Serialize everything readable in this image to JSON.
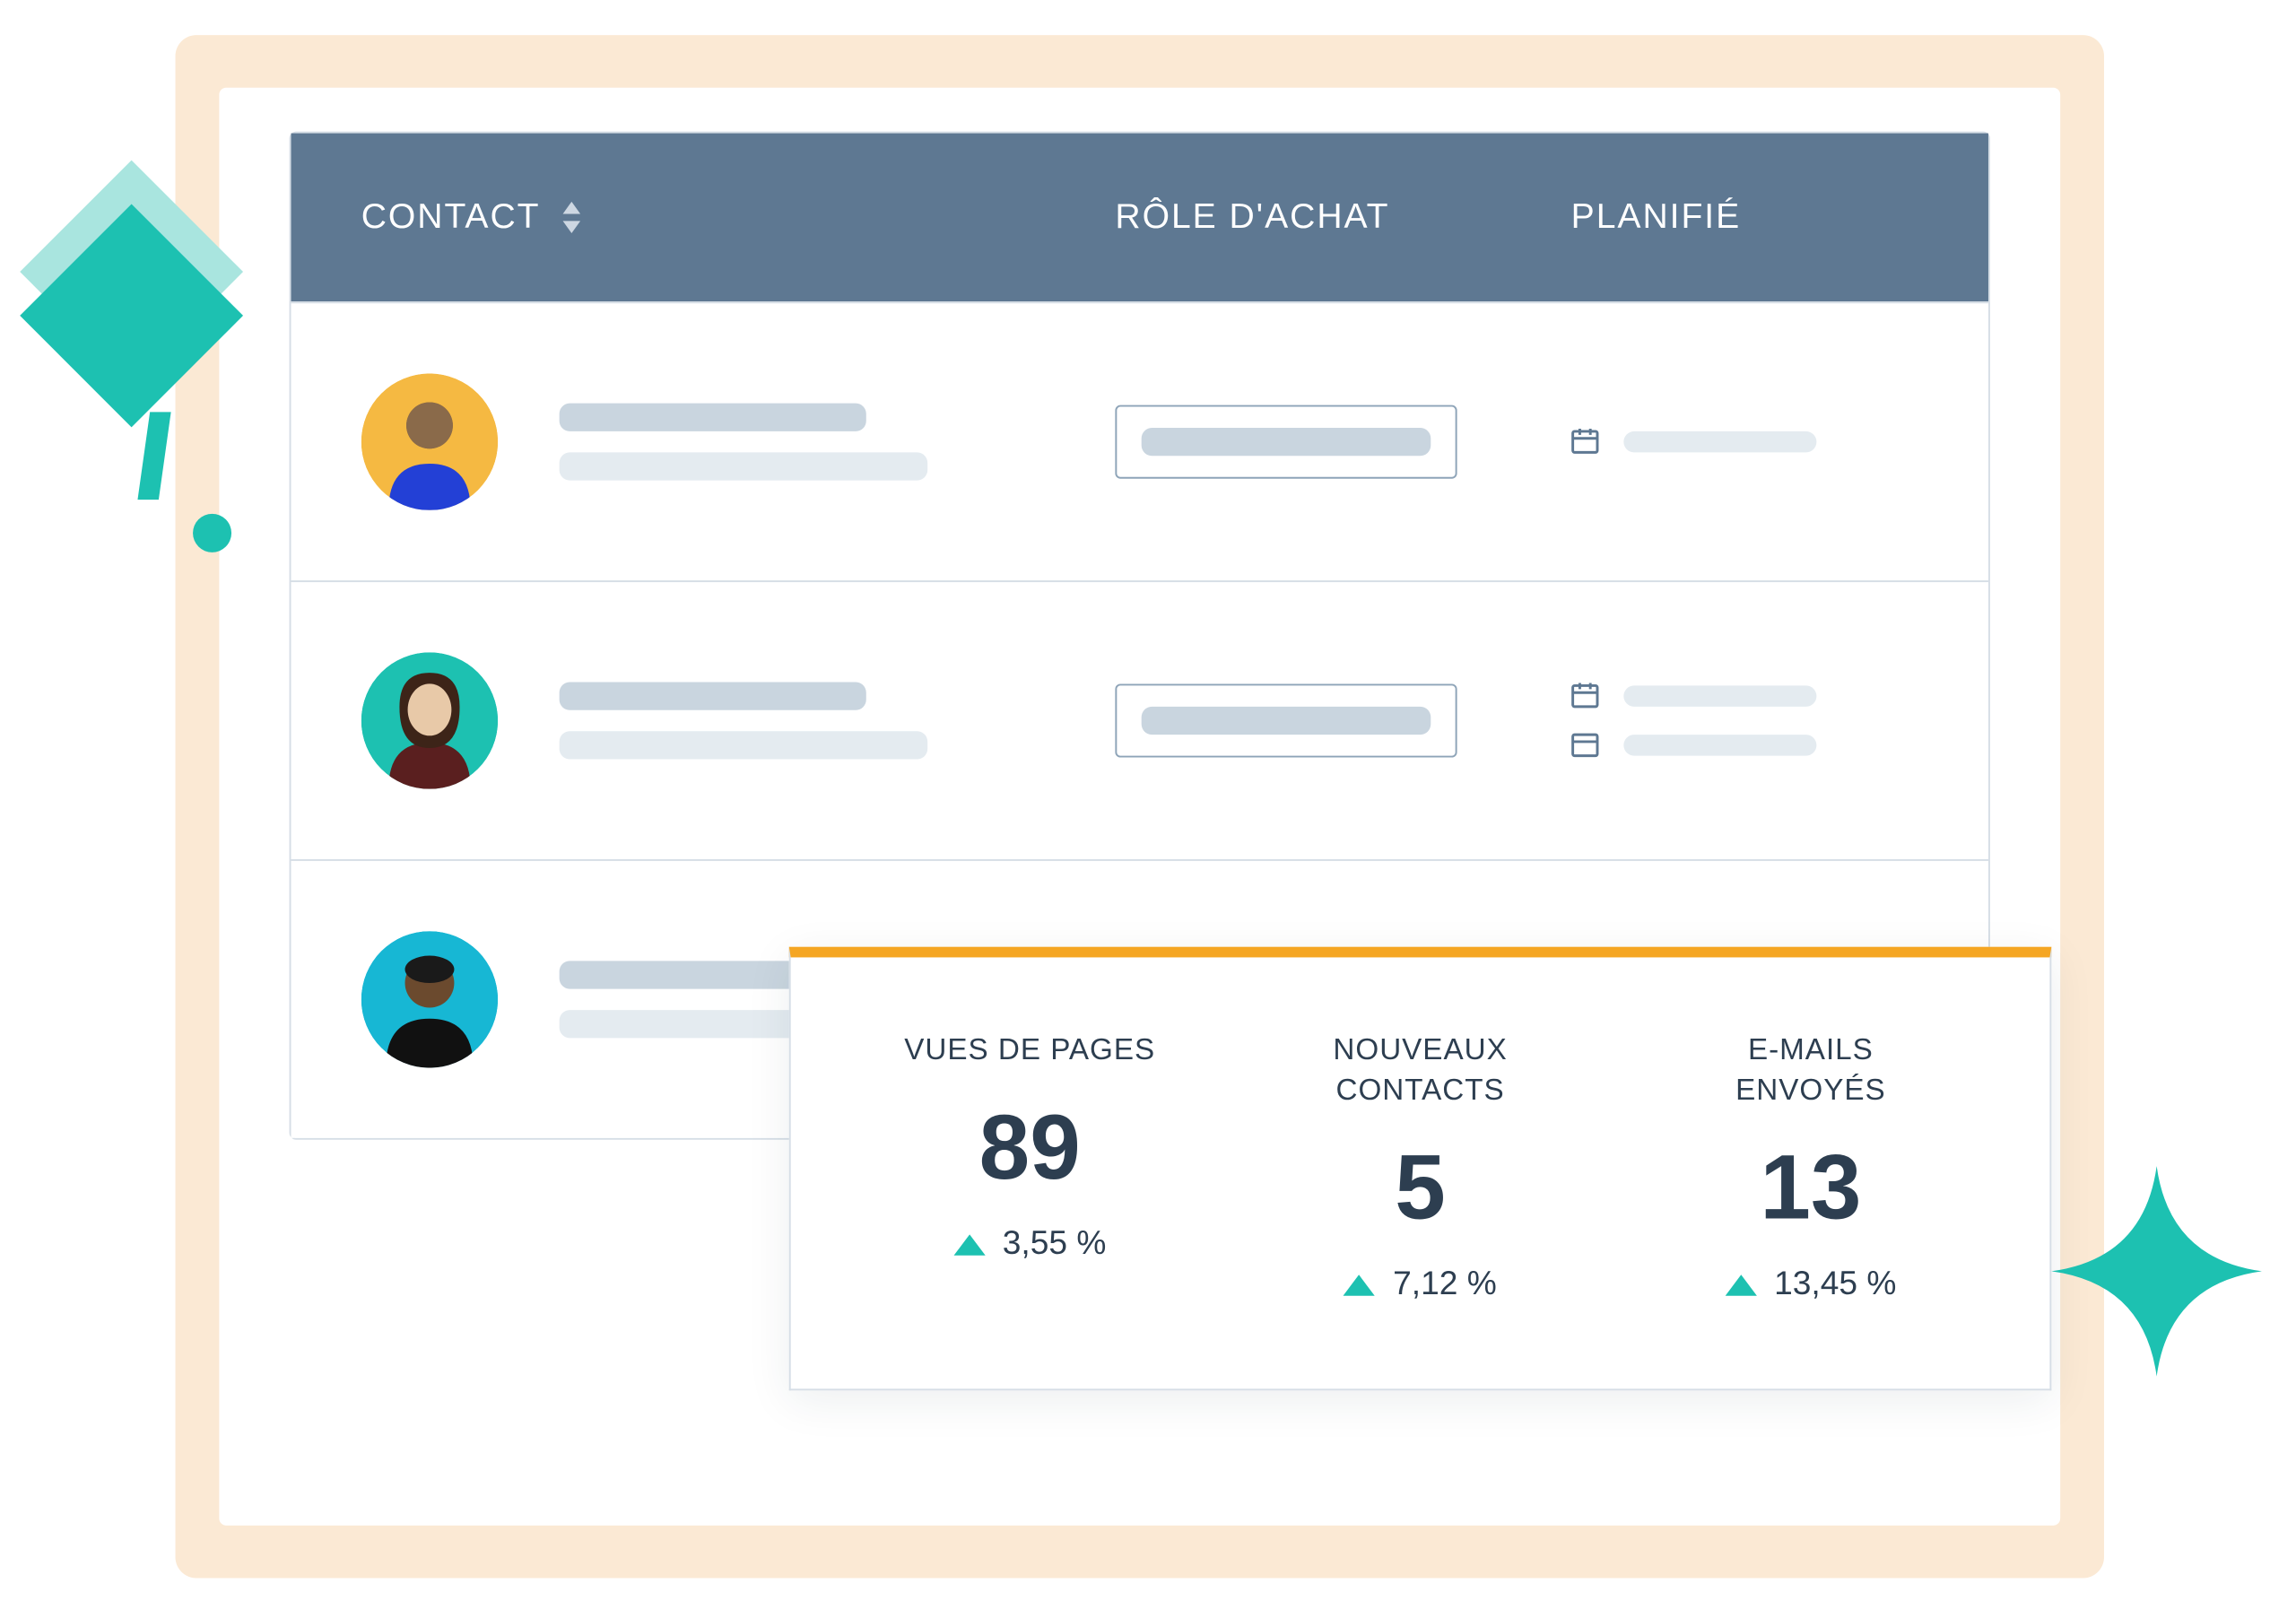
{
  "table": {
    "headers": {
      "contact": "CONTACT",
      "role": "RÔLE D'ACHAT",
      "planned": "PLANIFIÉ"
    },
    "rows": [
      {
        "avatar_bg": "#f5b942",
        "plan_icons": [
          "calendar"
        ]
      },
      {
        "avatar_bg": "#1dc1b1",
        "plan_icons": [
          "calendar",
          "window"
        ]
      },
      {
        "avatar_bg": "#17b7d4",
        "plan_icons": []
      }
    ]
  },
  "stats": [
    {
      "label": "VUES DE PAGES",
      "value": "89",
      "change": "3,55 %"
    },
    {
      "label": "NOUVEAUX\nCONTACTS",
      "value": "5",
      "change": "7,12 %"
    },
    {
      "label": "E-MAILS\nENVOYÉS",
      "value": "13",
      "change": "13,45 %"
    }
  ]
}
